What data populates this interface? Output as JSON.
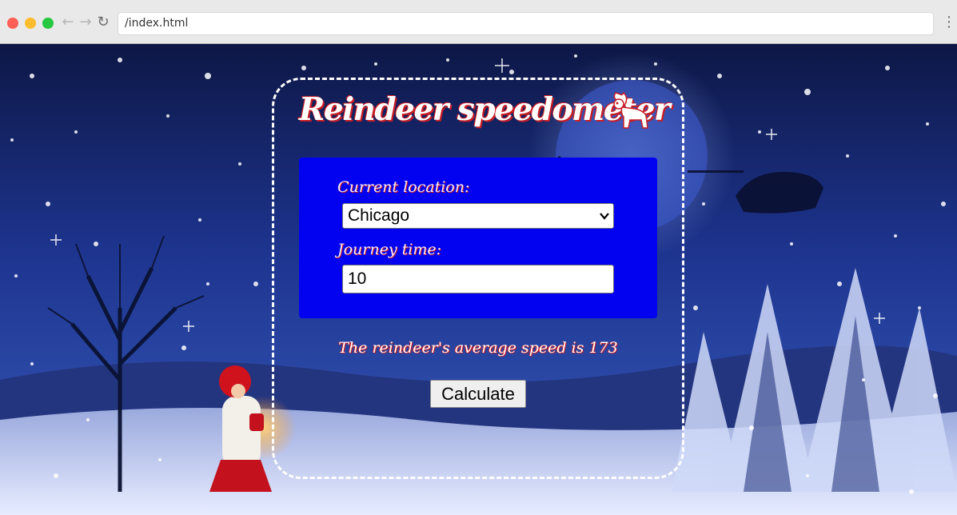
{
  "browser": {
    "url": "/index.html",
    "icons": {
      "back": "arrow-left-icon",
      "forward": "arrow-right-icon",
      "reload": "reload-icon",
      "menu": "vertical-dots-icon"
    }
  },
  "app": {
    "title": "Reindeer speedometer",
    "title_icon": "reindeer-icon",
    "location_label": "Current location:",
    "location_value": "Chicago",
    "journey_label": "Journey time:",
    "journey_value": "10",
    "result_text": "The reindeer's average speed is 173",
    "calculate_label": "Calculate"
  },
  "colors": {
    "panel": "#0202f0",
    "title_shadow": "#c81d25",
    "card_border": "#ffffff"
  }
}
